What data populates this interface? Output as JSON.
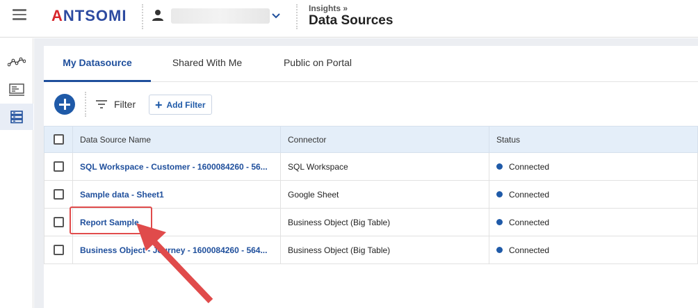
{
  "header": {
    "logo": {
      "prefix": "",
      "text_a": "A",
      "text_rest": "NTSOMI"
    },
    "breadcrumb": "Insights »",
    "title": "Data Sources"
  },
  "sidebar": {
    "items": [
      {
        "name": "analytics-icon",
        "active": false
      },
      {
        "name": "dashboard-icon",
        "active": false
      },
      {
        "name": "datasource-icon",
        "active": true
      }
    ]
  },
  "tabs": [
    {
      "label": "My Datasource",
      "active": true
    },
    {
      "label": "Shared With Me",
      "active": false
    },
    {
      "label": "Public on Portal",
      "active": false
    }
  ],
  "toolbar": {
    "filter_label": "Filter",
    "add_filter_label": "Add Filter"
  },
  "table": {
    "headers": [
      "Data Source Name",
      "Connector",
      "Status"
    ],
    "rows": [
      {
        "name": "SQL Workspace - Customer - 1600084260 - 56...",
        "connector": "SQL Workspace",
        "status": "Connected"
      },
      {
        "name": "Sample data - Sheet1",
        "connector": "Google Sheet",
        "status": "Connected"
      },
      {
        "name": "Report Sample",
        "connector": "Business Object (Big Table)",
        "status": "Connected"
      },
      {
        "name": "Business Object - Journey - 1600084260 - 564...",
        "connector": "Business Object (Big Table)",
        "status": "Connected"
      }
    ]
  },
  "colors": {
    "accent": "#1f4f9c",
    "status_connected": "#1f5aa8",
    "annotation": "#e04b4b"
  }
}
